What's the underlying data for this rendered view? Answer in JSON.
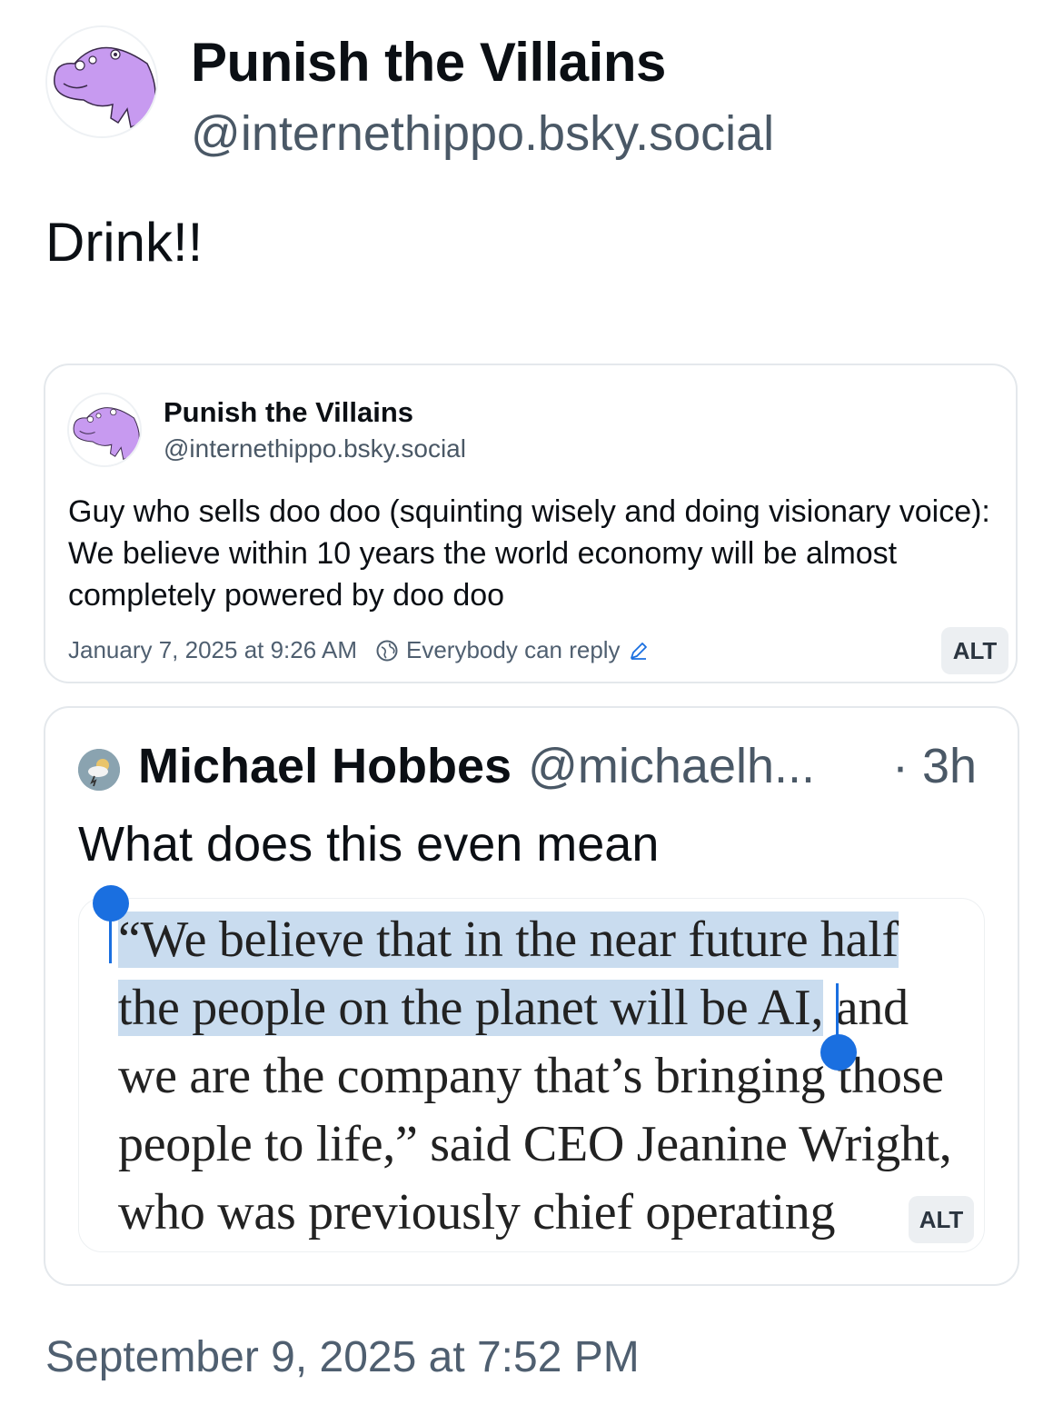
{
  "post": {
    "author_name": "Punish the Villains",
    "author_handle": "@internethippo.bsky.social",
    "text": "Drink!!",
    "timestamp": "September 9, 2025 at 7:52 PM",
    "avatar_icon": "purple-hippo-avatar"
  },
  "embed_post": {
    "author_name": "Punish the Villains",
    "author_handle": "@internethippo.bsky.social",
    "body": "Guy who sells doo doo (squinting wisely and doing visionary voice): We believe within 10 years the world economy will be almost completely powered by doo doo",
    "date": "January 7, 2025 at 9:26 AM",
    "reply_setting": "Everybody can reply",
    "alt_label": "ALT"
  },
  "quoted_post": {
    "author_name": "Michael Hobbes",
    "author_handle": "@michaelh...",
    "time_ago": "· 3h",
    "text": "What does this even mean",
    "image_alt_label": "ALT",
    "image_quote_lines": [
      {
        "highlighted": "“We believe that in the near future half",
        "rest": ""
      },
      {
        "highlighted": "the people on the planet will be AI,",
        "rest": " and"
      },
      {
        "highlighted": "",
        "rest": "we are the company that’s bringing those"
      },
      {
        "highlighted": "",
        "rest": "people to life,” said CEO Jeanine Wright,"
      },
      {
        "highlighted": "",
        "rest": "who was previously chief operating"
      }
    ]
  },
  "colors": {
    "accent": "#1a6fe0",
    "highlight": "#c9dcef",
    "secondary_text": "#4a5866",
    "avatar_purple": "#c79af0"
  }
}
